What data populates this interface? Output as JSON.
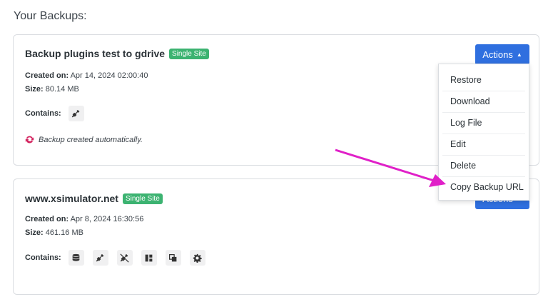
{
  "page_title": "Your Backups:",
  "backups": [
    {
      "title": "Backup plugins test to gdrive",
      "badge": "Single Site",
      "created_label": "Created on:",
      "created_value": "Apr 14, 2024 02:00:40",
      "size_label": "Size:",
      "size_value": "80.14 MB",
      "contains_label": "Contains:",
      "contains_icons": [
        "plugins-icon"
      ],
      "note": "Backup created automatically.",
      "actions_label": "Actions"
    },
    {
      "title": "www.xsimulator.net",
      "badge": "Single Site",
      "created_label": "Created on:",
      "created_value": "Apr 8, 2024 16:30:56",
      "size_label": "Size:",
      "size_value": "461.16 MB",
      "contains_label": "Contains:",
      "contains_icons": [
        "database-icon",
        "plugins-icon",
        "mu-plugins-icon",
        "themes-icon",
        "uploads-icon",
        "core-icon"
      ],
      "actions_label": "Actions"
    }
  ],
  "dropdown": {
    "items": [
      "Restore",
      "Download",
      "Log File",
      "Edit",
      "Delete",
      "Copy Backup URL"
    ]
  },
  "colors": {
    "accent": "#2f6fdf",
    "badge": "#3cb371",
    "annotation_arrow": "#e020c8",
    "sync_icon": "#d3245f"
  }
}
